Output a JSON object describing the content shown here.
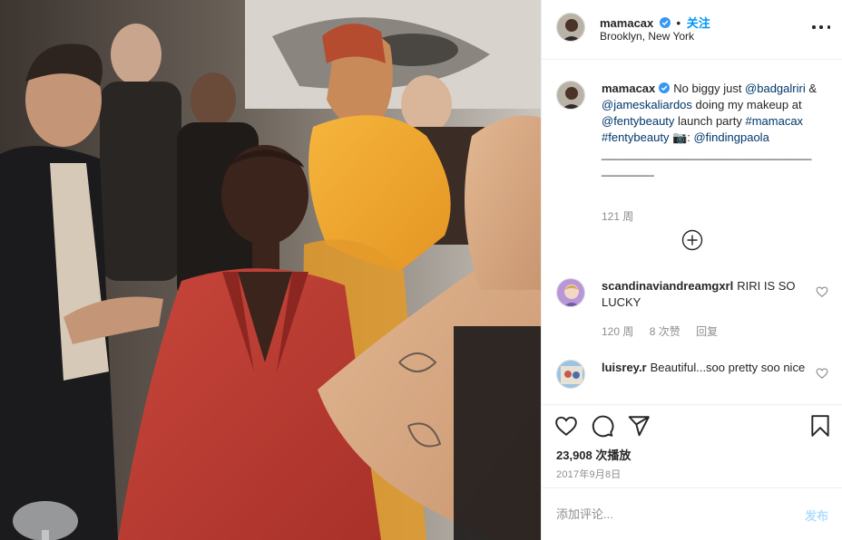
{
  "colors": {
    "link": "#00376b",
    "follow": "#0095f6",
    "verified": "#3897f0",
    "muted": "#8e8e8e",
    "post_disabled": "#b2dffc"
  },
  "media": {
    "description_icon": "video-frame"
  },
  "header": {
    "username": "mamacax",
    "verified_icon": "verified-badge-icon",
    "dot": "•",
    "follow_label": "关注",
    "location": "Brooklyn, New York",
    "more_icon": "more-options-icon"
  },
  "caption": {
    "username": "mamacax",
    "text_1": "No biggy just ",
    "mention_1": "@badgalriri",
    "text_2": " & ",
    "mention_2": "@jameskaliardos",
    "text_3": " doing my makeup at ",
    "mention_3": "@fentybeauty",
    "text_4": " launch party ",
    "hashtag_1": "#mamacax",
    "text_5": " ",
    "hashtag_2": "#fentybeauty",
    "text_6": " 📷: ",
    "mention_4": "@findingpaola",
    "rule": "________________________________________",
    "time": "121 周"
  },
  "load_more_icon": "plus-circle-icon",
  "comments": [
    {
      "username": "scandinaviandreamgxrl",
      "text": "RIRI IS SO LUCKY",
      "time": "120 周",
      "likes": "8 次赞",
      "reply": "回复"
    },
    {
      "username": "luisrey.r",
      "text": "Beautiful...soo pretty soo nice"
    }
  ],
  "actions": {
    "like_icon": "heart-icon",
    "comment_icon": "comment-icon",
    "share_icon": "send-icon",
    "save_icon": "bookmark-icon",
    "views_count": "23,908",
    "views_label": "次播放",
    "date": "2017年9月8日"
  },
  "add_comment": {
    "placeholder": "添加评论...",
    "post_label": "发布"
  }
}
